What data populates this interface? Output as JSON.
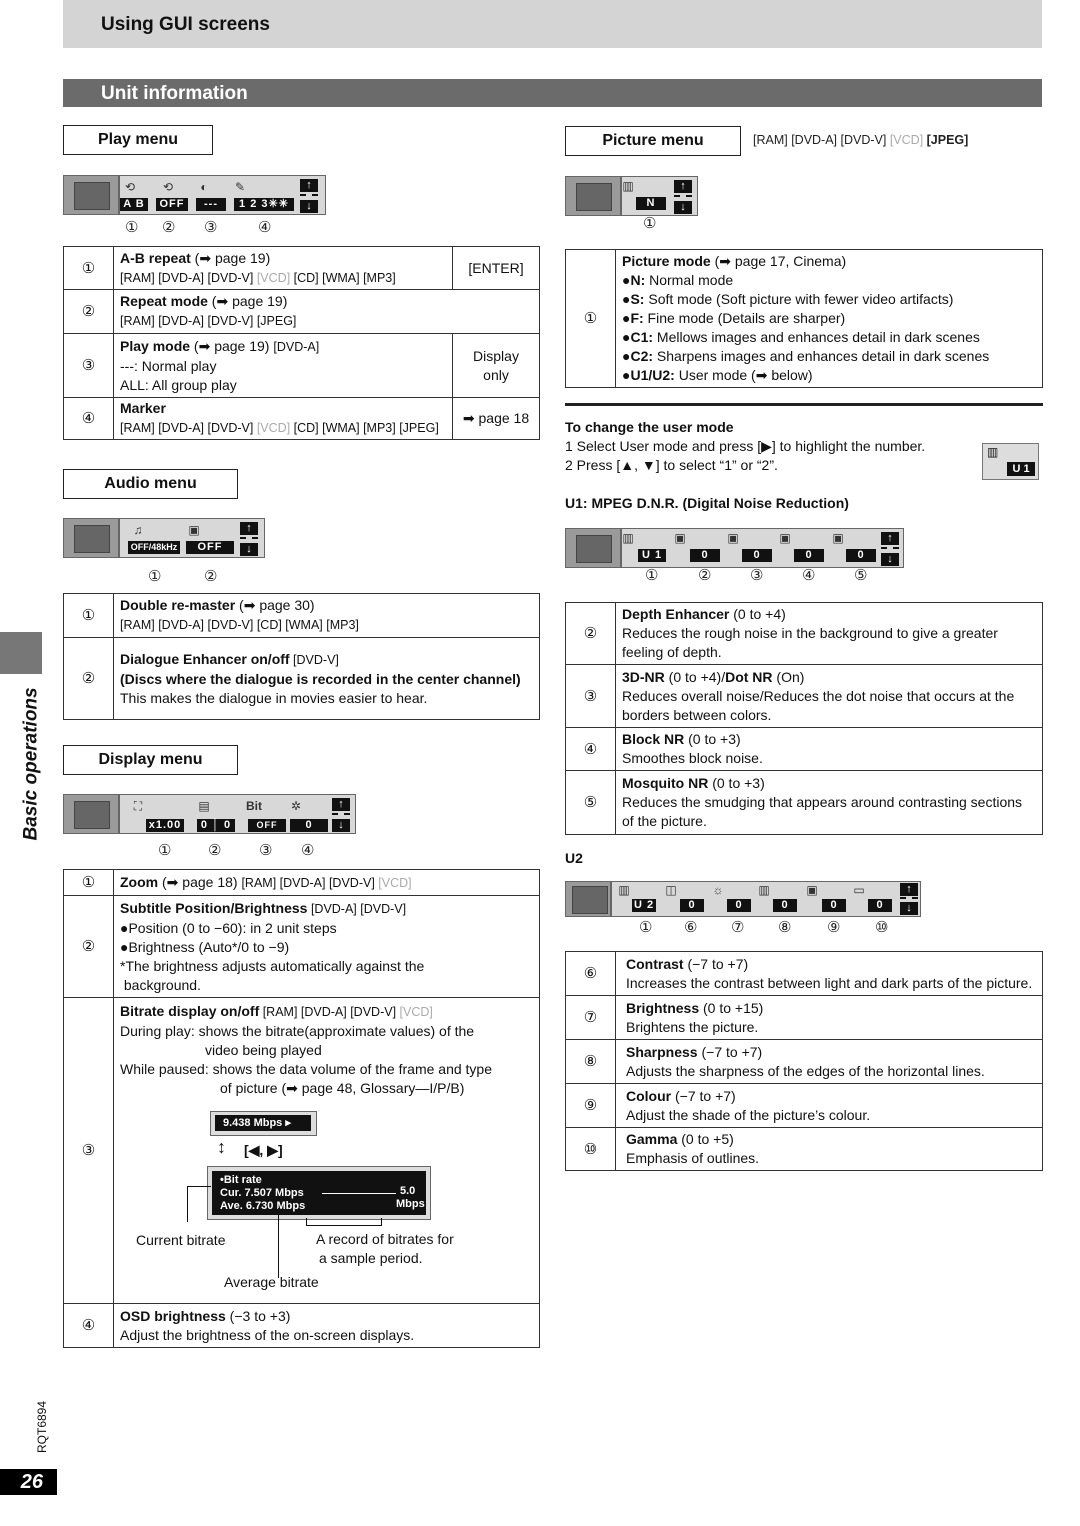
{
  "header": {
    "title": "Using GUI screens",
    "subtitle": "Unit information"
  },
  "side": {
    "label": "Basic operations",
    "doc_code": "RQT6894",
    "page_number": "26"
  },
  "play_menu": {
    "title": "Play menu",
    "osd": {
      "values": [
        "A B",
        "OFF",
        "---",
        "1 2 3✳✳"
      ],
      "callouts": [
        "①",
        "②",
        "③",
        "④"
      ]
    },
    "rows": [
      {
        "num": "①",
        "title": "A-B repeat",
        "ref": " (➡ page 19)",
        "tags": "[RAM] [DVD-A] [DVD-V] ",
        "vcd": "[VCD]",
        "tags2": " [CD] [WMA] [MP3]",
        "side": "[ENTER]"
      },
      {
        "num": "②",
        "title": "Repeat mode",
        "ref": " (➡ page 19)",
        "tags": "[RAM] [DVD-A] [DVD-V] [JPEG]"
      },
      {
        "num": "③",
        "title": "Play mode",
        "ref": " (➡ page 19) ",
        "tags": "[DVD-A]",
        "line2": "---:  Normal play",
        "line3": "ALL:  All group play",
        "side": "Display only"
      },
      {
        "num": "④",
        "title": "Marker",
        "tags": "[RAM] [DVD-A] [DVD-V] ",
        "vcd": "[VCD]",
        "tags2": " [CD] [WMA] [MP3] [JPEG]",
        "side": "➡ page 18"
      }
    ]
  },
  "audio_menu": {
    "title": "Audio menu",
    "osd": {
      "values": [
        "OFF/48kHz",
        "OFF"
      ],
      "callouts": [
        "①",
        "②"
      ]
    },
    "rows": [
      {
        "num": "①",
        "title": "Double re-master",
        "ref": " (➡ page 30)",
        "tags": "[RAM] [DVD-A] [DVD-V] [CD] [WMA] [MP3]"
      },
      {
        "num": "②",
        "title": "Dialogue Enhancer on/off",
        "tags": " [DVD-V]",
        "bold2": "(Discs where the dialogue is recorded in the center channel)",
        "desc": "This makes the dialogue in movies easier to hear."
      }
    ]
  },
  "display_menu": {
    "title": "Display menu",
    "osd": {
      "values": [
        "x1.00",
        "0 │ 0",
        "OFF",
        "0"
      ],
      "callouts": [
        "①",
        "②",
        "③",
        "④"
      ]
    },
    "rows": [
      {
        "num": "①",
        "title": "Zoom",
        "ref": " (➡ page 18) ",
        "tags": "[RAM] [DVD-A] [DVD-V] ",
        "vcd": "[VCD]"
      },
      {
        "num": "②",
        "title": "Subtitle Position/Brightness",
        "tags": " [DVD-A] [DVD-V]",
        "l1": "●Position (0 to −60):  in 2 unit steps",
        "l2": "●Brightness (Auto*/0 to −9)",
        "l3": "*The brightness adjusts automatically against the",
        "l4": "background."
      },
      {
        "num": "③",
        "title": "Bitrate display on/off",
        "tags": " [RAM] [DVD-A] [DVD-V] ",
        "vcd": "[VCD]",
        "l1": "During play:  shows the bitrate(approximate values) of the",
        "l1b": "video being  played",
        "l2": "While paused:  shows the data volume of the frame and type",
        "l2b": "of picture (➡ page 48, Glossary—I/P/B)",
        "small_osd": "9.438 Mbps  ▸",
        "keys": "[◀, ▶]",
        "big_osd": {
          "title": "•Bit rate",
          "cur": "Cur.  7.507 Mbps",
          "ave": "Ave.  6.730 Mbps",
          "scale": "5.0",
          "unit": "Mbps"
        },
        "label_current": "Current bitrate",
        "label_record1": "A record of bitrates for",
        "label_record2": "a sample period.",
        "label_average": "Average bitrate"
      },
      {
        "num": "④",
        "title": "OSD brightness",
        "ref": " (−3 to +3)",
        "desc": "Adjust the brightness of the on-screen displays."
      }
    ]
  },
  "picture_menu": {
    "title": "Picture menu",
    "tags": "[RAM] [DVD-A] [DVD-V] ",
    "vcd": "[VCD]",
    "jpeg": " [JPEG]",
    "osd": {
      "value": "N",
      "callout": "①"
    },
    "row": {
      "num": "①",
      "title": "Picture mode",
      "ref": " (➡ page 17, Cinema)",
      "items": [
        {
          "k": "●N:",
          "v": "  Normal mode"
        },
        {
          "k": "●S:",
          "v": "  Soft mode (Soft picture with fewer video artifacts)"
        },
        {
          "k": "●F:",
          "v": "  Fine mode (Details are sharper)"
        },
        {
          "k": "●C1:",
          "v": " Mellows images and enhances detail in dark scenes"
        },
        {
          "k": "●C2:",
          "v": " Sharpens images and enhances detail in dark scenes"
        },
        {
          "k": "●U1/U2:",
          "v": "  User mode (➡ below)"
        }
      ]
    }
  },
  "user_mode": {
    "heading": "To change the user mode",
    "step1": "1 Select User mode and press [▶] to highlight the number.",
    "step2": "2 Press [▲, ▼] to select “1” or “2”.",
    "osd_value": "U 1"
  },
  "u1": {
    "heading": "U1: MPEG D.N.R. (Digital Noise Reduction)",
    "osd": {
      "values": [
        "U 1",
        "0",
        "0",
        "0",
        "0"
      ],
      "callouts": [
        "①",
        "②",
        "③",
        "④",
        "⑤"
      ]
    },
    "rows": [
      {
        "num": "②",
        "title": "Depth Enhancer",
        "ref": " (0 to +4)",
        "desc": "Reduces the rough noise in the background to give a greater feeling of depth."
      },
      {
        "num": "③",
        "title": "3D-NR",
        "ref": " (0 to +4)/",
        "title2": "Dot NR",
        "ref2": " (On)",
        "desc": "Reduces overall noise/Reduces the dot noise that occurs at the borders between colors."
      },
      {
        "num": "④",
        "title": "Block NR",
        "ref": " (0 to +3)",
        "desc": "Smoothes block noise."
      },
      {
        "num": "⑤",
        "title": "Mosquito NR",
        "ref": " (0 to +3)",
        "desc": "Reduces the smudging that appears around contrasting sections of the picture."
      }
    ]
  },
  "u2": {
    "heading": "U2",
    "osd": {
      "values": [
        "U 2",
        "0",
        "0",
        "0",
        "0",
        "0"
      ],
      "callouts": [
        "①",
        "⑥",
        "⑦",
        "⑧",
        "⑨",
        "⑩"
      ]
    },
    "rows": [
      {
        "num": "⑥",
        "title": "Contrast",
        "ref": " (−7 to +7)",
        "desc": "Increases the contrast between light and dark parts of the picture."
      },
      {
        "num": "⑦",
        "title": "Brightness",
        "ref": " (0 to +15)",
        "desc": "Brightens the picture."
      },
      {
        "num": "⑧",
        "title": "Sharpness",
        "ref": " (−7 to +7)",
        "desc": "Adjusts the sharpness of the edges of the horizontal lines."
      },
      {
        "num": "⑨",
        "title": "Colour",
        "ref": " (−7 to +7)",
        "desc": "Adjust the shade of the picture’s colour."
      },
      {
        "num": "⑩",
        "title": "Gamma",
        "ref": " (0 to +5)",
        "desc": "Emphasis of outlines."
      }
    ]
  },
  "icons": {
    "up": "↑",
    "down": "↓"
  }
}
